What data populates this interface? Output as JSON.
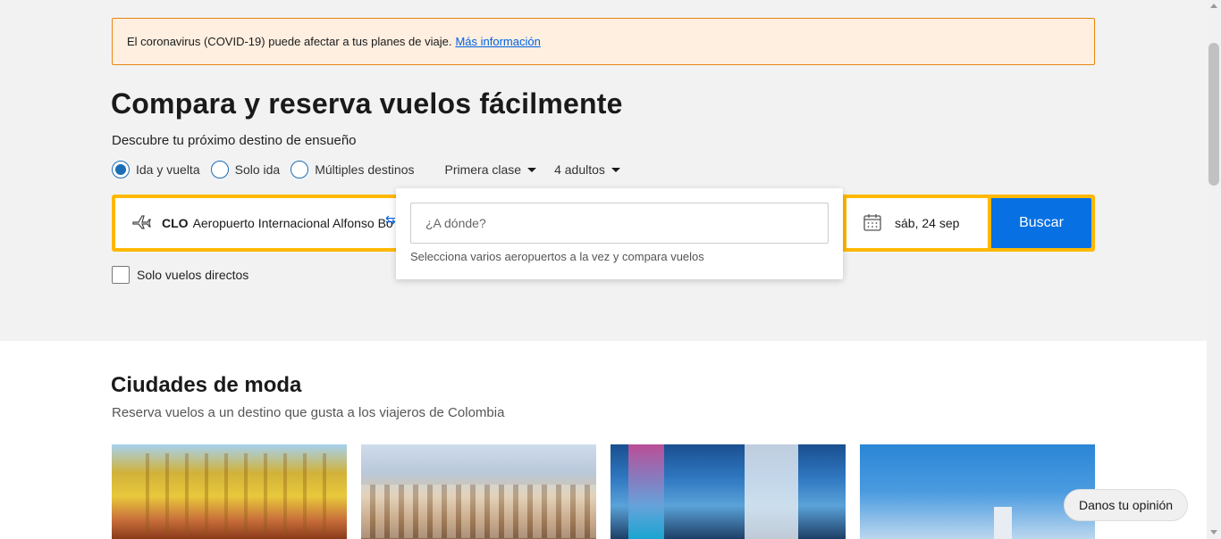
{
  "banner": {
    "text": "El coronavirus (COVID-19) puede afectar a tus planes de viaje.",
    "link": "Más información"
  },
  "hero": {
    "title": "Compara y reserva vuelos fácilmente",
    "subtitle": "Descubre tu próximo destino de ensueño"
  },
  "trip_options": {
    "radios": [
      {
        "label": "Ida y vuelta",
        "checked": true
      },
      {
        "label": "Solo ida",
        "checked": false
      },
      {
        "label": "Múltiples destinos",
        "checked": false
      }
    ],
    "cabin_class": "Primera clase",
    "passengers": "4 adultos"
  },
  "search": {
    "origin_code": "CLO",
    "origin_name": "Aeropuerto Internacional Alfonso Bo",
    "destination_placeholder": "¿A dónde?",
    "destination_hint": "Selecciona varios aeropuertos a la vez y compara vuelos",
    "date": "sáb, 24 sep",
    "button": "Buscar",
    "direct_only_label": "Solo vuelos directos",
    "direct_only_checked": false
  },
  "trending": {
    "title": "Ciudades de moda",
    "subtitle": "Reserva vuelos a un destino que gusta a los viajeros de Colombia"
  },
  "feedback_label": "Danos tu opinión",
  "colors": {
    "banner_bg": "#feefe0",
    "banner_border": "#e88511",
    "search_border": "#ffb800",
    "accent_blue": "#0770e3",
    "link_blue": "#0062e3"
  },
  "icons": {
    "origin": "plane-icon",
    "swap": "swap-arrows-icon",
    "date": "calendar-icon",
    "caret": "chevron-down-icon"
  }
}
